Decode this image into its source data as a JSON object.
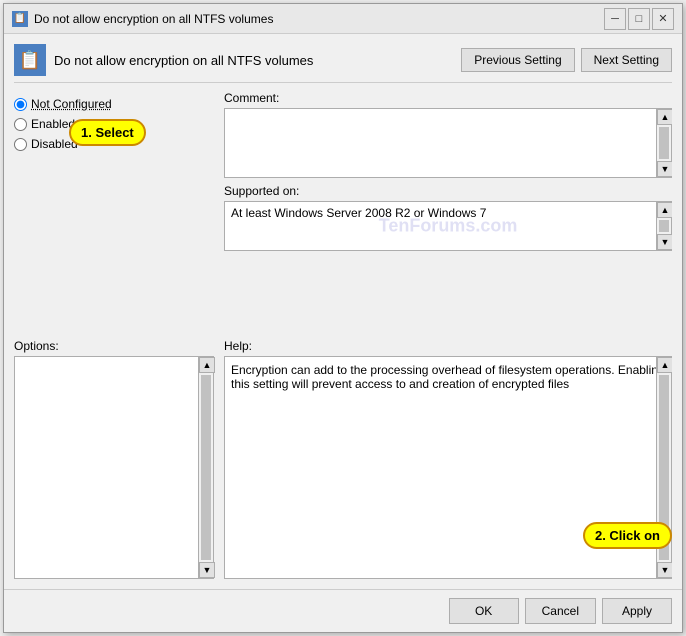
{
  "window": {
    "title": "Do not allow encryption on all NTFS volumes",
    "icon_char": "📋"
  },
  "titlebar_controls": {
    "minimize": "─",
    "maximize": "□",
    "close": "✕"
  },
  "header": {
    "title": "Do not allow encryption on all NTFS volumes",
    "prev_button": "Previous Setting",
    "next_button": "Next Setting"
  },
  "radio_options": {
    "not_configured": "Not Configured",
    "enabled": "Enabled",
    "disabled": "Disabled"
  },
  "comment_label": "Comment:",
  "supported_label": "Supported on:",
  "supported_value": "At least Windows Server 2008 R2 or Windows 7",
  "watermark": "TenForums.com",
  "options_label": "Options:",
  "help_label": "Help:",
  "help_text": "Encryption can add to the processing overhead of filesystem operations.  Enabling this setting will prevent access to and creation of encrypted files",
  "annotations": {
    "select": "1. Select",
    "click": "2. Click on"
  },
  "footer": {
    "ok": "OK",
    "cancel": "Cancel",
    "apply": "Apply"
  }
}
